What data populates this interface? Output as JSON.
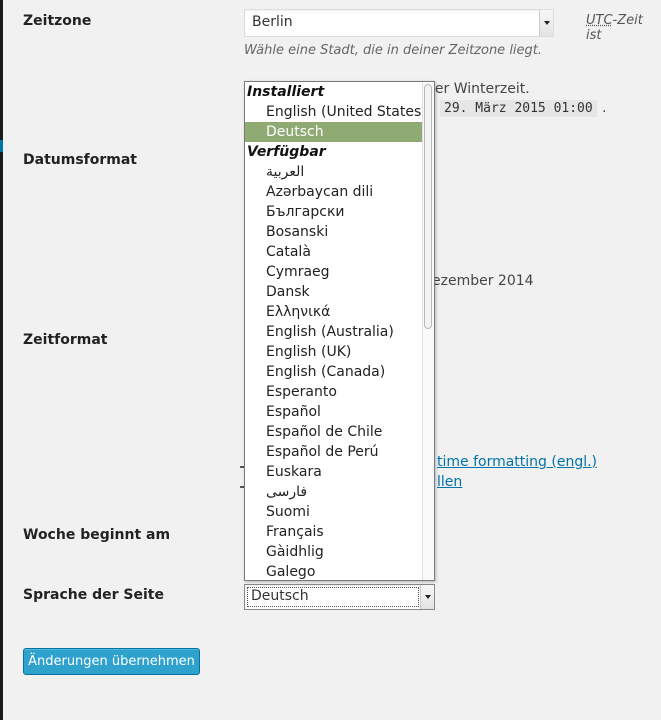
{
  "rows": {
    "timezone_label": "Zeitzone",
    "date_format_label": "Datumsformat",
    "time_format_label": "Zeitformat",
    "week_starts_label": "Woche beginnt am",
    "site_language_label": "Sprache der Seite"
  },
  "timezone": {
    "value": "Berlin",
    "description": "Wähle eine Stadt, die in deiner Zeitzone liegt.",
    "utc_abbr": "UTC",
    "utc_text": "-Zeit ist"
  },
  "background": {
    "winter_time": "der Winterzeit.",
    "next_change": "29. März 2015 01:00",
    "next_change_suffix": ".",
    "date_example": "ezember 2014",
    "doc_link_1": "time formatting (engl.)",
    "doc_link_2": "llen"
  },
  "language_select": {
    "value": "Deutsch",
    "options": [
      {
        "label": "Installiert",
        "group": true
      },
      {
        "label": "English (United States)"
      },
      {
        "label": "Deutsch",
        "selected": true
      },
      {
        "label": "Verfügbar",
        "group": true
      },
      {
        "label": "العربية"
      },
      {
        "label": "Azərbaycan dili"
      },
      {
        "label": "Български"
      },
      {
        "label": "Bosanski"
      },
      {
        "label": "Català"
      },
      {
        "label": "Cymraeg"
      },
      {
        "label": "Dansk"
      },
      {
        "label": "Ελληνικά"
      },
      {
        "label": "English (Australia)"
      },
      {
        "label": "English (UK)"
      },
      {
        "label": "English (Canada)"
      },
      {
        "label": "Esperanto"
      },
      {
        "label": "Español"
      },
      {
        "label": "Español de Chile"
      },
      {
        "label": "Español de Perú"
      },
      {
        "label": "Euskara"
      },
      {
        "label": "فارسی"
      },
      {
        "label": "Suomi"
      },
      {
        "label": "Français"
      },
      {
        "label": "Gàidhlig"
      },
      {
        "label": "Galego"
      }
    ]
  },
  "actions": {
    "save_label": "Änderungen übernehmen"
  },
  "colors": {
    "selected_option": "#8faa73",
    "primary_button": "#2ea2cc",
    "link": "#0073aa"
  },
  "icons": [
    "chevron-down-icon"
  ]
}
